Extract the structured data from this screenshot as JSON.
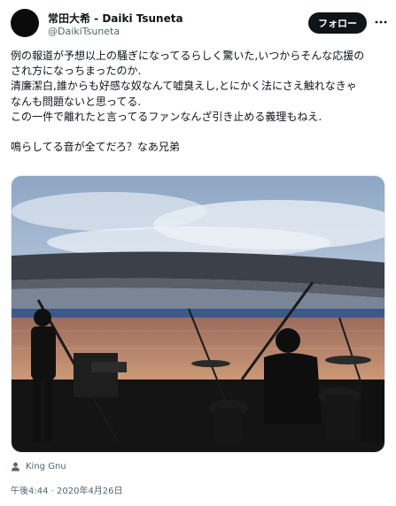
{
  "author": {
    "display_name": "常田大希 - Daiki Tsuneta",
    "handle": "@DaikiTsuneta"
  },
  "follow_button": {
    "label": "フォロー"
  },
  "more_icon": "three-dots-icon",
  "tweet": {
    "lines": [
      "例の報道が予想以上の騒ぎになってるらしく驚いた,いつからそんな応援の",
      "され方になっちまったのか.",
      "清廉潔白,誰からも好感な奴なんて嘘臭えし,とにかく法にさえ触れなきゃ",
      "なんも問題ないと思ってる.",
      "この一件で離れたと言ってるファンなんざ引き止める義理もねえ.",
      "",
      "鳴らしてる音が全てだろ？なあ兄弟"
    ]
  },
  "photo": {
    "description_icon": "stadium-concert-photo"
  },
  "media_credit": {
    "icon": "person-icon",
    "label": "King Gnu"
  },
  "timestamp": "午後4:44 · 2020年4月26日",
  "colors": {
    "text_primary": "#0f1419",
    "text_secondary": "#536471",
    "follow_bg": "#0f1419"
  }
}
